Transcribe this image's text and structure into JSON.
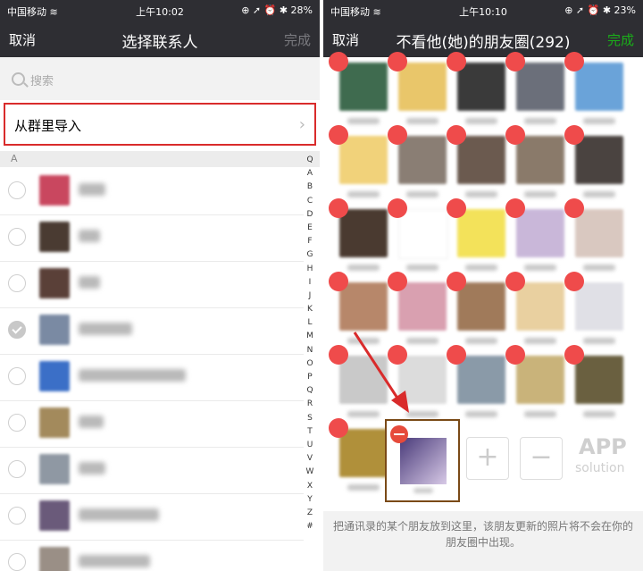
{
  "left": {
    "status": {
      "carrier": "中国移动 ≋",
      "time": "上午10:02",
      "battery": "⊕ ➚ ⏰ ✱ 28%"
    },
    "nav": {
      "cancel": "取消",
      "title": "选择联系人",
      "done": "完成"
    },
    "search": {
      "placeholder": "搜索"
    },
    "group_import": "从群里导入",
    "section_letter": "A",
    "contacts": [
      {
        "checked": false,
        "avatar_color": "#c9475f"
      },
      {
        "checked": false,
        "avatar_color": "#4a3b32"
      },
      {
        "checked": false,
        "avatar_color": "#5a4038"
      },
      {
        "checked": true,
        "avatar_color": "#7a8aa3"
      },
      {
        "checked": false,
        "avatar_color": "#3b6fc7"
      },
      {
        "checked": false,
        "avatar_color": "#a38a5c"
      },
      {
        "checked": false,
        "avatar_color": "#8f98a3"
      },
      {
        "checked": false,
        "avatar_color": "#6a5a7a"
      },
      {
        "checked": false,
        "avatar_color": "#9a8f86"
      }
    ],
    "index_letters": [
      "Q",
      "A",
      "B",
      "C",
      "D",
      "E",
      "F",
      "G",
      "H",
      "I",
      "J",
      "K",
      "L",
      "M",
      "N",
      "O",
      "P",
      "Q",
      "R",
      "S",
      "T",
      "U",
      "V",
      "W",
      "X",
      "Y",
      "Z",
      "#"
    ]
  },
  "right": {
    "status": {
      "carrier": "中国移动 ≋",
      "time": "上午10:10",
      "battery": "⊕ ➚ ⏰ ✱ 23%"
    },
    "nav": {
      "cancel": "取消",
      "title": "不看他(她)的朋友圈(292)",
      "done": "完成"
    },
    "grid_colors": [
      "#3f6b4f",
      "#e9c66a",
      "#3a3a3a",
      "#6b6f7a",
      "#6aa3d9",
      "#f1d27a",
      "#8a7e74",
      "#6b5a4f",
      "#8a7a6a",
      "#4a4340",
      "#4a3a30",
      "#ffffff",
      "#f3e25a",
      "#c9b7d9",
      "#d9c8c0",
      "#b7876a",
      "#d9a0b0",
      "#a07a5a",
      "#e9d0a0",
      "#e0e0e6",
      "#c9c9c9",
      "#dcdcdc",
      "#8a9aa8",
      "#c9b37a",
      "#6a6040",
      "#b0903a"
    ],
    "add_button": "+",
    "remove_button": "−",
    "watermark": {
      "app": "APP",
      "solution": "solution"
    },
    "footer": "把通讯录的某个朋友放到这里，该朋友更新的照片将不会在你的朋友圈中出现。"
  }
}
